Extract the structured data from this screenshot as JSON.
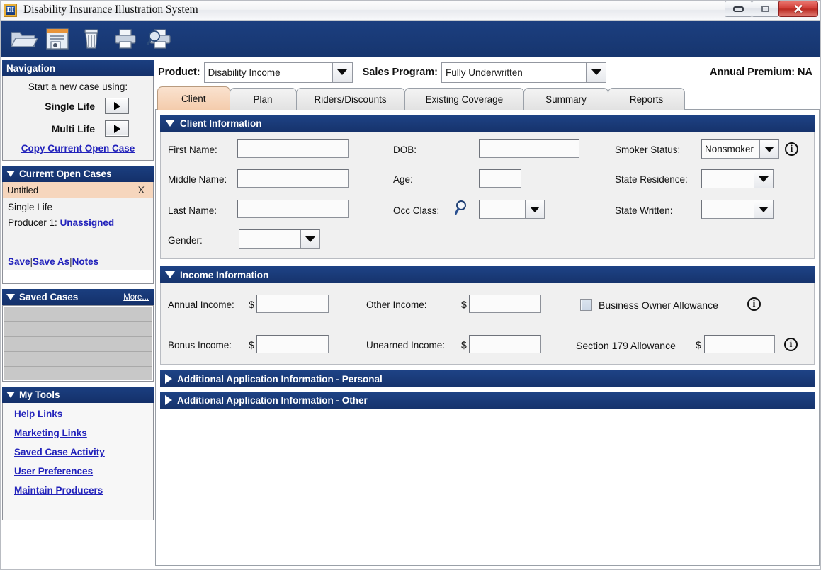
{
  "window": {
    "title": "Disability Insurance Illustration System",
    "app_icon_text": "DI",
    "controls": {
      "minimize": "minimize-icon",
      "maximize": "maximize-icon",
      "close": "✕"
    }
  },
  "toolbar": {
    "items": [
      {
        "name": "open-icon",
        "label": "Open"
      },
      {
        "name": "save-icon",
        "label": "Save"
      },
      {
        "name": "delete-icon",
        "label": "Delete"
      },
      {
        "name": "print-icon",
        "label": "Print"
      },
      {
        "name": "print-preview-icon",
        "label": "Print Preview"
      }
    ]
  },
  "sidebar": {
    "navigation": {
      "title": "Navigation",
      "prompt": "Start a new case using:",
      "options": [
        {
          "label": "Single Life"
        },
        {
          "label": "Multi Life"
        }
      ],
      "copy_link": "Copy Current Open Case"
    },
    "current_open_cases": {
      "title": "Current Open Cases",
      "selected_case": "Untitled",
      "close_symbol": "X",
      "case_type": "Single Life",
      "producer_label": "Producer 1:",
      "producer_value": "Unassigned",
      "actions": {
        "save": "Save",
        "sep1": "|",
        "save_as": "Save As",
        "sep2": "|",
        "notes": "Notes"
      }
    },
    "saved_cases": {
      "title": "Saved Cases",
      "more": "More...",
      "rows": [
        "",
        "",
        "",
        "",
        ""
      ]
    },
    "my_tools": {
      "title": "My Tools",
      "links": [
        "Help Links",
        "Marketing Links",
        "Saved Case Activity",
        "User Preferences",
        "Maintain Producers"
      ]
    }
  },
  "topbar": {
    "product_label": "Product:",
    "product_value": "Disability Income",
    "sales_program_label": "Sales Program:",
    "sales_program_value": "Fully Underwritten",
    "annual_premium": "Annual Premium: NA"
  },
  "tabs": [
    {
      "label": "Client",
      "active": true
    },
    {
      "label": "Plan",
      "active": false
    },
    {
      "label": "Riders/Discounts",
      "active": false
    },
    {
      "label": "Existing Coverage",
      "active": false
    },
    {
      "label": "Summary",
      "active": false
    },
    {
      "label": "Reports",
      "active": false
    }
  ],
  "client_information": {
    "title": "Client Information",
    "first_name_label": "First Name:",
    "first_name_value": "",
    "middle_name_label": "Middle Name:",
    "middle_name_value": "",
    "last_name_label": "Last Name:",
    "last_name_value": "",
    "gender_label": "Gender:",
    "gender_value": "",
    "dob_label": "DOB:",
    "dob_value": "",
    "age_label": "Age:",
    "age_value": "",
    "occ_class_label": "Occ Class:",
    "occ_class_value": "",
    "smoker_status_label": "Smoker Status:",
    "smoker_status_value": "Nonsmoker",
    "state_residence_label": "State Residence:",
    "state_residence_value": "",
    "state_written_label": "State Written:",
    "state_written_value": ""
  },
  "income_information": {
    "title": "Income Information",
    "annual_income_label": "Annual Income:",
    "annual_income_value": "",
    "bonus_income_label": "Bonus Income:",
    "bonus_income_value": "",
    "other_income_label": "Other Income:",
    "other_income_value": "",
    "unearned_income_label": "Unearned Income:",
    "unearned_income_value": "",
    "currency_symbol": "$",
    "business_owner_allowance_label": "Business Owner Allowance",
    "business_owner_allowance_checked": false,
    "section_179_label": "Section 179 Allowance",
    "section_179_value": ""
  },
  "collapsed_sections": [
    {
      "title": "Additional Application Information - Personal"
    },
    {
      "title": "Additional Application Information - Other"
    }
  ],
  "colors": {
    "header_blue": "#1b3f80",
    "toolbar_blue": "#16356e",
    "active_tab_peach": "#f4ccac",
    "link_blue": "#2222bb",
    "close_red": "#ba2a22"
  }
}
